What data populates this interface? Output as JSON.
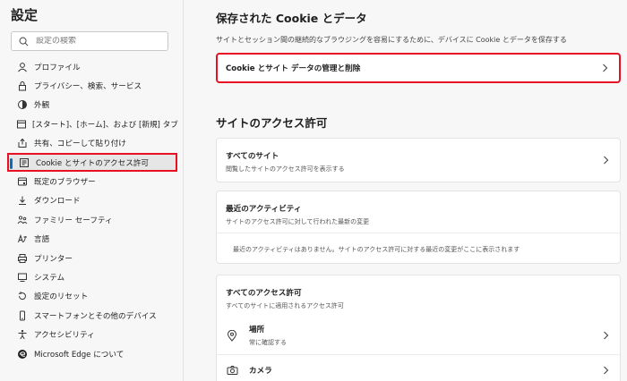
{
  "sidebar": {
    "title": "設定",
    "search_placeholder": "設定の検索",
    "items": [
      {
        "label": "プロファイル",
        "icon": "profile-icon"
      },
      {
        "label": "プライバシー、検索、サービス",
        "icon": "lock-icon"
      },
      {
        "label": "外観",
        "icon": "appearance-icon"
      },
      {
        "label": "[スタート]、[ホーム]、および [新規] タブ",
        "icon": "home-tab-icon"
      },
      {
        "label": "共有、コピーして貼り付け",
        "icon": "share-icon"
      },
      {
        "label": "Cookie とサイトのアクセス許可",
        "icon": "cookie-permissions-icon",
        "active": true
      },
      {
        "label": "既定のブラウザー",
        "icon": "browser-icon"
      },
      {
        "label": "ダウンロード",
        "icon": "download-icon"
      },
      {
        "label": "ファミリー セーフティ",
        "icon": "family-icon"
      },
      {
        "label": "言語",
        "icon": "language-icon"
      },
      {
        "label": "プリンター",
        "icon": "printer-icon"
      },
      {
        "label": "システム",
        "icon": "system-icon"
      },
      {
        "label": "設定のリセット",
        "icon": "reset-icon"
      },
      {
        "label": "スマートフォンとその他のデバイス",
        "icon": "phone-icon"
      },
      {
        "label": "アクセシビリティ",
        "icon": "accessibility-icon"
      },
      {
        "label": "Microsoft Edge について",
        "icon": "edge-icon"
      }
    ]
  },
  "main": {
    "cookies_heading": "保存された Cookie とデータ",
    "cookies_desc": "サイトとセッション間の継続的なブラウジングを容易にするために、デバイスに Cookie とデータを保存する",
    "manage_cookies_label": "Cookie とサイト データの管理と削除",
    "permissions_heading": "サイトのアクセス許可",
    "all_sites": {
      "title": "すべてのサイト",
      "subtitle": "閲覧したサイトのアクセス許可を表示する"
    },
    "recent_activity": {
      "title": "最近のアクティビティ",
      "subtitle": "サイトのアクセス許可に対して行われた最新の変更",
      "empty": "最近のアクティビティはありません。サイトのアクセス許可に対する最近の変更がここに表示されます"
    },
    "all_permissions": {
      "title": "すべてのアクセス許可",
      "subtitle": "すべてのサイトに適用されるアクセス許可",
      "location": {
        "title": "場所",
        "subtitle": "常に確認する"
      },
      "camera": {
        "title": "カメラ"
      }
    }
  },
  "colors": {
    "highlight": "#e81123",
    "accent": "#0f6cbd"
  }
}
